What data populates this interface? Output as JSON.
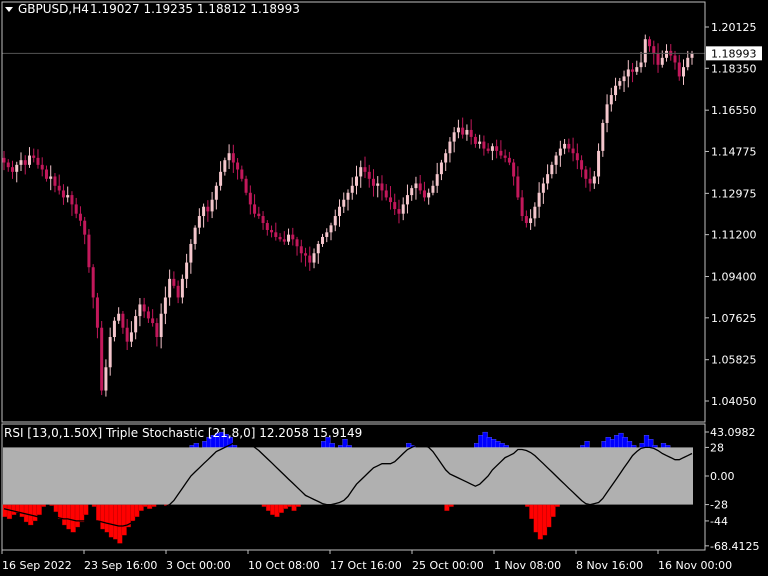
{
  "header": {
    "symbol": "GBPUSD,H4",
    "ohlc": "1.19027 1.19235 1.18812 1.18993",
    "menu_icon": "triangle-down-icon"
  },
  "indicator_header": "RSI [13,0,1.50X] Triple Stochastic [21,8,0] 12.2058 15.9149",
  "colors": {
    "background": "#000000",
    "bull_candle": "#f4c6cc",
    "bear_candle": "#c2185b",
    "axis": "#c0c0c0",
    "rsi_positive": "#0000ff",
    "rsi_negative": "#ff0000",
    "band": "#b0b0b0",
    "signal_line": "#000000",
    "current_price_line": "#555555"
  },
  "chart_data": [
    {
      "type": "candlestick",
      "title": "GBPUSD,H4",
      "current_price": 1.18993,
      "ylim": [
        1.031,
        1.212
      ],
      "yticks": [
        1.20125,
        1.1835,
        1.1655,
        1.14775,
        1.12975,
        1.112,
        1.094,
        1.07625,
        1.05825,
        1.0405
      ],
      "ytick_labels": [
        "1.20125",
        "1.18350",
        "1.16550",
        "1.14775",
        "1.12975",
        "1.11200",
        "1.09400",
        "1.07625",
        "1.05825",
        "1.04050"
      ],
      "xtick_labels": [
        "16 Sep 2022",
        "23 Sep 16:00",
        "3 Oct 00:00",
        "10 Oct 08:00",
        "17 Oct 16:00",
        "25 Oct 00:00",
        "1 Nov 08:00",
        "8 Nov 16:00",
        "16 Nov 00:00"
      ],
      "close_path": [
        1.143,
        1.141,
        1.139,
        1.142,
        1.144,
        1.142,
        1.146,
        1.145,
        1.142,
        1.14,
        1.136,
        1.137,
        1.133,
        1.131,
        1.128,
        1.129,
        1.125,
        1.121,
        1.118,
        1.112,
        1.098,
        1.085,
        1.072,
        1.045,
        1.055,
        1.068,
        1.075,
        1.078,
        1.072,
        1.066,
        1.07,
        1.077,
        1.082,
        1.079,
        1.076,
        1.074,
        1.068,
        1.078,
        1.085,
        1.093,
        1.09,
        1.085,
        1.093,
        1.1,
        1.108,
        1.115,
        1.12,
        1.124,
        1.122,
        1.127,
        1.133,
        1.139,
        1.144,
        1.147,
        1.143,
        1.14,
        1.136,
        1.13,
        1.125,
        1.121,
        1.12,
        1.117,
        1.114,
        1.113,
        1.111,
        1.11,
        1.109,
        1.112,
        1.11,
        1.107,
        1.104,
        1.103,
        1.1,
        1.104,
        1.108,
        1.111,
        1.113,
        1.116,
        1.12,
        1.124,
        1.127,
        1.13,
        1.133,
        1.137,
        1.141,
        1.139,
        1.136,
        1.133,
        1.134,
        1.131,
        1.128,
        1.126,
        1.123,
        1.121,
        1.125,
        1.129,
        1.132,
        1.134,
        1.131,
        1.128,
        1.13,
        1.133,
        1.138,
        1.143,
        1.147,
        1.152,
        1.156,
        1.158,
        1.155,
        1.157,
        1.154,
        1.151,
        1.152,
        1.149,
        1.148,
        1.15,
        1.148,
        1.146,
        1.145,
        1.143,
        1.137,
        1.128,
        1.12,
        1.117,
        1.119,
        1.124,
        1.13,
        1.134,
        1.138,
        1.142,
        1.146,
        1.149,
        1.151,
        1.149,
        1.147,
        1.144,
        1.14,
        1.136,
        1.134,
        1.137,
        1.148,
        1.16,
        1.168,
        1.172,
        1.176,
        1.178,
        1.18,
        1.183,
        1.182,
        1.184,
        1.186,
        1.196,
        1.193,
        1.19,
        1.185,
        1.188,
        1.191,
        1.189,
        1.186,
        1.18,
        1.184,
        1.188,
        1.19
      ]
    },
    {
      "type": "histogram_with_line",
      "title": "RSI [13,0,1.50X] Triple Stochastic [21,8,0]",
      "values_shown": [
        12.2058,
        15.9149
      ],
      "ylim": [
        -68.4125,
        43.0982
      ],
      "yticks": [
        43.0982,
        28,
        0.0,
        -28,
        -44,
        -68.4125
      ],
      "ytick_labels": [
        "43.0982",
        "28",
        "0.00",
        "-28",
        "-44",
        "-68.4125"
      ],
      "band": [
        -28,
        28
      ],
      "rsi_histogram": [
        -40,
        -42,
        -38,
        -36,
        -40,
        -45,
        -48,
        -44,
        -38,
        -30,
        -28,
        -29,
        -35,
        -42,
        -48,
        -52,
        -55,
        -50,
        -45,
        -38,
        -28,
        -30,
        -44,
        -52,
        -55,
        -60,
        -62,
        -66,
        -58,
        -50,
        -44,
        -40,
        -34,
        -30,
        -32,
        -30,
        -28,
        -28,
        -29,
        -28,
        -12,
        0,
        10,
        20,
        30,
        32,
        28,
        34,
        38,
        40,
        42,
        43,
        41,
        38,
        30,
        20,
        8,
        0,
        -10,
        -20,
        -28,
        -30,
        -34,
        -38,
        -40,
        -36,
        -32,
        -30,
        -34,
        -30,
        -28,
        -20,
        -10,
        10,
        26,
        34,
        38,
        32,
        28,
        30,
        36,
        30,
        28,
        10,
        0,
        -5,
        -12,
        -10,
        -8,
        -5,
        0,
        5,
        10,
        20,
        26,
        32,
        30,
        28,
        20,
        10,
        0,
        -10,
        -20,
        -28,
        -34,
        -30,
        -20,
        -10,
        0,
        10,
        26,
        32,
        40,
        43,
        38,
        36,
        34,
        32,
        30,
        28,
        10,
        0,
        -20,
        -30,
        -42,
        -55,
        -62,
        -58,
        -50,
        -40,
        -30,
        -20,
        -10,
        0,
        10,
        26,
        30,
        34,
        28,
        20,
        28,
        34,
        38,
        36,
        40,
        42,
        38,
        34,
        30,
        28,
        32,
        40,
        36,
        30,
        28,
        32,
        30,
        28,
        26,
        20,
        14,
        10,
        8
      ],
      "signal_line": [
        -32,
        -33,
        -34,
        -35,
        -36,
        -37,
        -38,
        -39,
        -40,
        -40,
        -40,
        -40,
        -40,
        -41,
        -42,
        -42,
        -43,
        -44,
        -44,
        -44,
        -44,
        -44,
        -44,
        -45,
        -46,
        -47,
        -48,
        -49,
        -49,
        -48,
        -46,
        -44,
        -42,
        -40,
        -38,
        -36,
        -34,
        -32,
        -30,
        -28,
        -24,
        -18,
        -12,
        -6,
        0,
        4,
        8,
        12,
        16,
        20,
        24,
        26,
        28,
        30,
        32,
        33,
        34,
        33,
        31,
        28,
        25,
        21,
        17,
        13,
        9,
        5,
        1,
        -3,
        -7,
        -11,
        -15,
        -19,
        -21,
        -23,
        -25,
        -27,
        -28,
        -28,
        -27,
        -26,
        -24,
        -20,
        -14,
        -8,
        -4,
        0,
        4,
        8,
        10,
        12,
        12,
        12,
        14,
        18,
        22,
        26,
        28,
        30,
        31,
        30,
        28,
        24,
        18,
        12,
        6,
        2,
        0,
        -2,
        -4,
        -6,
        -8,
        -10,
        -8,
        -4,
        0,
        6,
        10,
        14,
        18,
        20,
        22,
        26,
        26,
        25,
        23,
        20,
        16,
        12,
        8,
        4,
        0,
        -4,
        -8,
        -12,
        -16,
        -20,
        -24,
        -27,
        -28,
        -27,
        -26,
        -22,
        -16,
        -10,
        -4,
        2,
        8,
        14,
        20,
        24,
        27,
        28,
        28,
        27,
        25,
        22,
        20,
        18,
        16,
        16,
        18,
        20,
        22
      ]
    }
  ]
}
